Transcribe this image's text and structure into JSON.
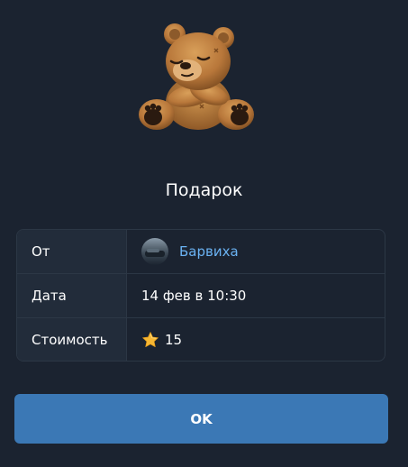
{
  "gift": {
    "icon": "teddy-bear-icon",
    "title": "Подарок"
  },
  "details": {
    "from_label": "От",
    "from_name": "Барвиха",
    "from_color": "#6ab2f2",
    "date_label": "Дата",
    "date_value": "14 фев в 10:30",
    "cost_label": "Стоимость",
    "cost_icon": "star-icon",
    "cost_value": "15"
  },
  "actions": {
    "ok_label": "OK",
    "ok_color": "#3b78b5"
  },
  "theme": {
    "background": "#1b2330",
    "label_column": "#222c3a",
    "border": "#2c3745"
  }
}
